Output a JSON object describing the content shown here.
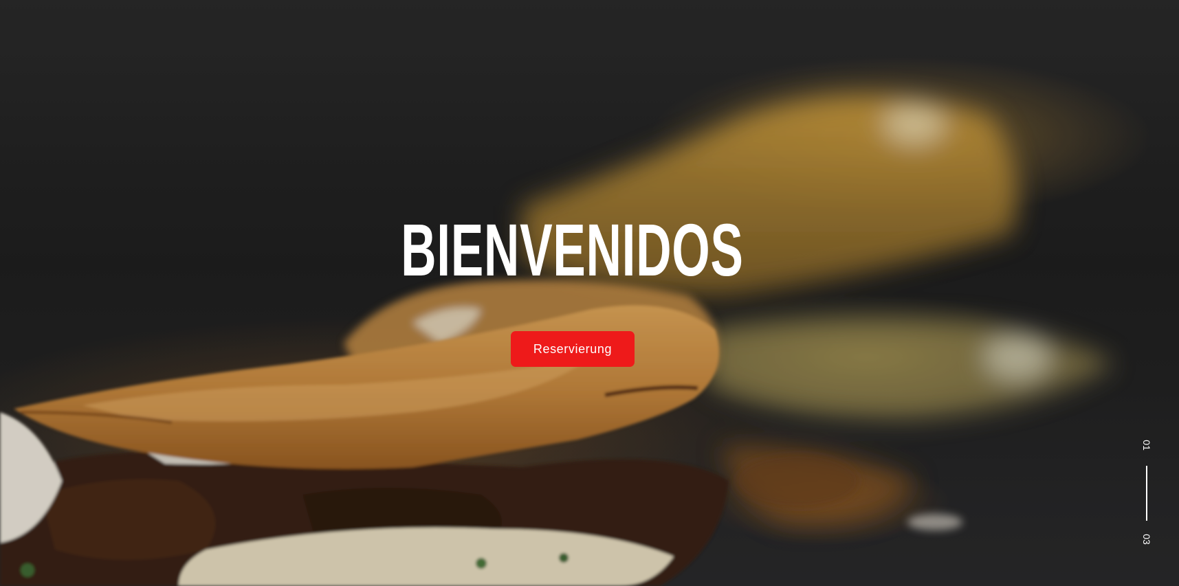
{
  "hero": {
    "headline": "BIENVENIDOS",
    "cta_label": "Reservierung",
    "background_image": "blurred-quesadilla-photo"
  },
  "slider": {
    "current": "01",
    "total": "03",
    "progress": 0.33
  },
  "colors": {
    "accent": "#ee1a1a",
    "text": "#ffffff",
    "background": "#1f1f1f"
  }
}
